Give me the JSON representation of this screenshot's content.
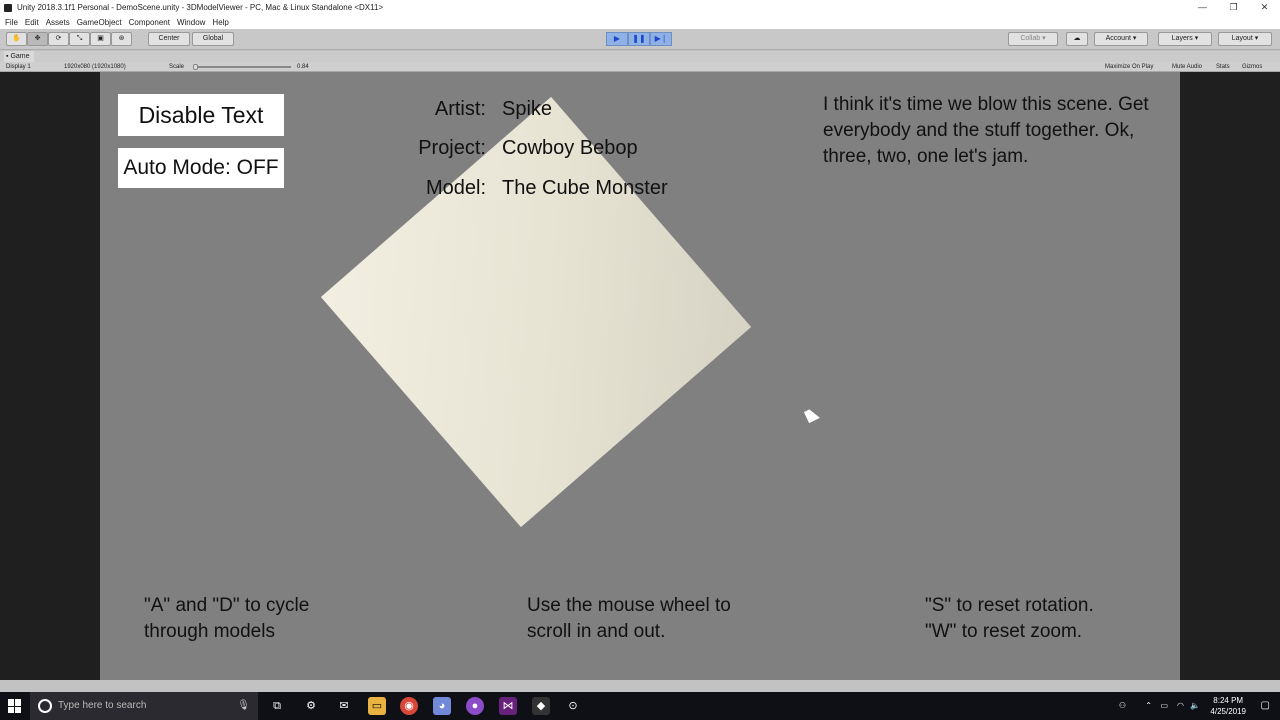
{
  "window": {
    "title": "Unity 2018.3.1f1 Personal - DemoScene.unity - 3DModelViewer - PC, Mac & Linux Standalone <DX11>",
    "minimize": "—",
    "maximize": "❐",
    "close": "✕"
  },
  "menu": [
    "File",
    "Edit",
    "Assets",
    "GameObject",
    "Component",
    "Window",
    "Help"
  ],
  "toolbar": {
    "pivot": "Center",
    "space": "Global",
    "collab": "Collab",
    "account": "Account",
    "layers": "Layers",
    "layout": "Layout"
  },
  "game_view": {
    "tab": "Game",
    "display": "Display 1",
    "resolution": "1920x080 (1920x1080)",
    "scale_label": "Scale",
    "scale_value": "0.84",
    "maximize_on_play": "Maximize On Play",
    "mute_audio": "Mute Audio",
    "stats": "Stats",
    "gizmos": "Gizmos"
  },
  "scene": {
    "disable_text": "Disable Text",
    "auto_mode": "Auto Mode: OFF",
    "artist_label": "Artist:",
    "artist_value": "Spike",
    "project_label": "Project:",
    "project_value": "Cowboy Bebop",
    "model_label": "Model:",
    "model_value": "The Cube Monster",
    "quote": "I think it's time we blow this scene. Get everybody and the stuff together. Ok, three, two, one let's jam.",
    "hint_cycle": "\"A\" and \"D\" to cycle through models",
    "hint_wheel": "Use the mouse wheel to scroll in and out.",
    "hint_reset_rotation": "\"S\" to reset rotation.",
    "hint_reset_zoom": "\"W\" to reset zoom."
  },
  "taskbar": {
    "search_placeholder": "Type here to search",
    "time": "8:24 PM",
    "date": "4/25/2019"
  }
}
